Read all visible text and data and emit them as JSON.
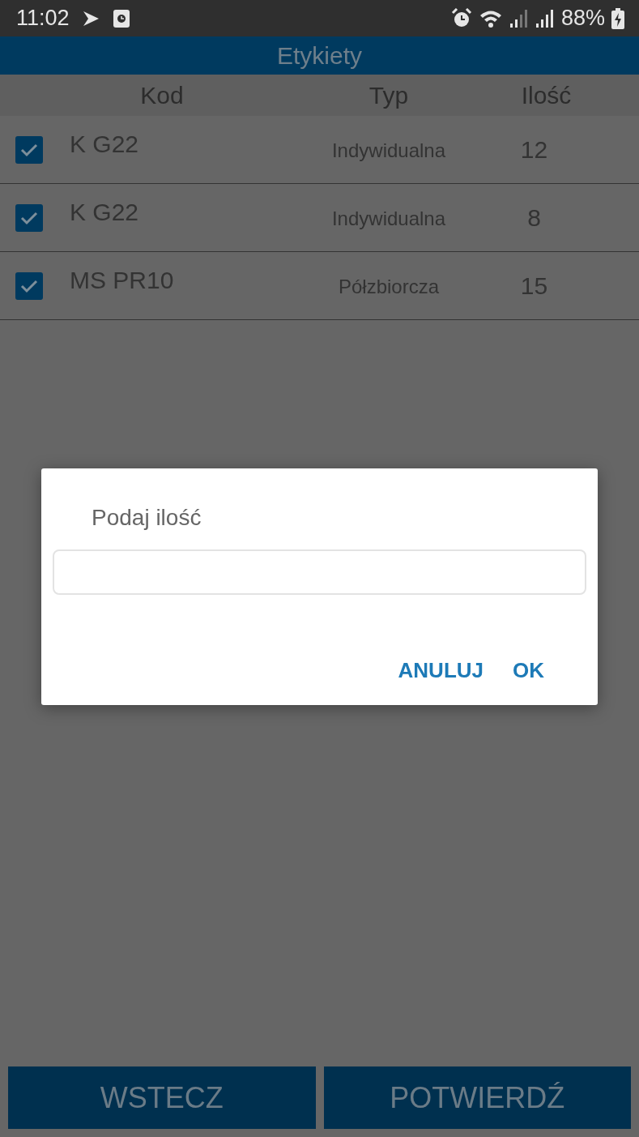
{
  "status_bar": {
    "time": "11:02",
    "battery": "88%"
  },
  "header": {
    "title": "Etykiety"
  },
  "table": {
    "columns": [
      "Kod",
      "Typ",
      "Ilość"
    ],
    "rows": [
      {
        "checked": true,
        "code": "K G22",
        "type": "Indywidualna",
        "quantity": "12"
      },
      {
        "checked": true,
        "code": "K G22",
        "type": "Indywidualna",
        "quantity": "8"
      },
      {
        "checked": true,
        "code": "MS PR10",
        "type": "Półzbiorcza",
        "quantity": "15"
      }
    ]
  },
  "dialog": {
    "title": "Podaj ilość",
    "buttons": [
      "ANULUJ",
      "OK"
    ]
  },
  "buttons": [
    "WSTECZ",
    "POTWIERDŹ"
  ]
}
